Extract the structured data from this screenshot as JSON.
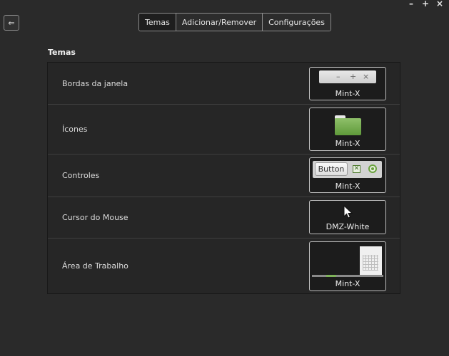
{
  "window": {
    "controls": [
      "–",
      "+",
      "×"
    ]
  },
  "toolbar": {
    "back_glyph": "⇐",
    "back_icon": "back-arrow-icon"
  },
  "tabs": [
    {
      "label": "Temas",
      "active": true
    },
    {
      "label": "Adicionar/Remover",
      "active": false
    },
    {
      "label": "Configurações",
      "active": false
    }
  ],
  "section": {
    "title": "Temas"
  },
  "rows": [
    {
      "label": "Bordas da janela",
      "theme": "Mint-X",
      "preview": "window-border-preview",
      "preview_buttons": [
        "–",
        "+",
        "×"
      ]
    },
    {
      "label": "Ícones",
      "theme": "Mint-X",
      "preview": "folder-icon"
    },
    {
      "label": "Controles",
      "theme": "Mint-X",
      "preview": "controls-preview",
      "button_text": "Button"
    },
    {
      "label": "Cursor do Mouse",
      "theme": "DMZ-White",
      "preview": "pointer-cursor-icon"
    },
    {
      "label": "Área de Trabalho",
      "theme": "Mint-X",
      "preview": "desktop-preview"
    }
  ],
  "colors": {
    "background": "#2a2a2a",
    "panel": "#262626",
    "accent_green": "#6aa23e"
  }
}
